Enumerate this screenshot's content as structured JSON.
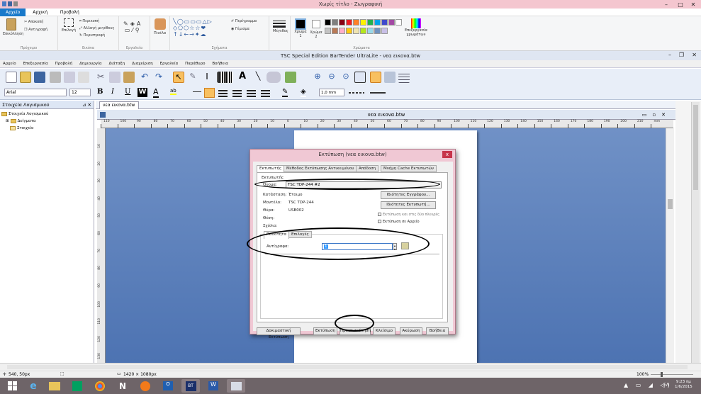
{
  "paint": {
    "title": "Χωρίς τίτλο - Ζωγραφική",
    "tabs": [
      "Αρχείο",
      "Αρχική",
      "Προβολή"
    ],
    "clipboard": {
      "paste": "Επικόλληση",
      "cut": "Αποκοπή",
      "copy": "Αντιγραφή",
      "label": "Πρόχειρο"
    },
    "image": {
      "select": "Επιλογή",
      "crop": "Περικοπή",
      "resize": "Αλλαγή μεγέθους",
      "rotate": "Περιστροφή",
      "label": "Εικόνα"
    },
    "tools": {
      "label": "Εργαλεία"
    },
    "brushes": {
      "label": "Πινέλα"
    },
    "shapes": {
      "outline": "Περίγραμμα",
      "fill": "Γέμισμα",
      "label": "Σχήματα"
    },
    "size": {
      "label": "Μέγεθος"
    },
    "colors": {
      "color1": "Χρώμα 1",
      "color2": "Χρώμα 2",
      "edit": "Επεξεργασία χρωμάτων",
      "label": "Χρώματα"
    },
    "palette": [
      "#000000",
      "#7f7f7f",
      "#880015",
      "#ed1c24",
      "#ff7f27",
      "#fff200",
      "#22b14c",
      "#00a2e8",
      "#3f48cc",
      "#a349a4",
      "#ffffff",
      "#c3c3c3",
      "#b97a57",
      "#ffaec9",
      "#ffc90e",
      "#efe4b0",
      "#b5e61d",
      "#99d9ea",
      "#7092be",
      "#c8bfe7"
    ]
  },
  "bartender": {
    "title": "TSC Special Edition BarTender UltraLite - νεα εικονα.btw",
    "menu": [
      "Αρχείο",
      "Επεξεργασία",
      "Προβολή",
      "Δημιουργία",
      "Διάταξη",
      "Διαχείριση",
      "Εργαλεία",
      "Παράθυρο",
      "Βοήθεια"
    ],
    "font_name": "Arial",
    "font_size": "12",
    "bold": "B",
    "italic": "I",
    "underline": "U",
    "line_width": "1,0 mm",
    "tree_title": "Στοιχεία Λογισμικού",
    "tree_items": [
      "Στοιχεία Λογισμικού",
      "Δείγματα",
      "Στοιχείο"
    ],
    "doc_tab": "νεα εικονα.btw",
    "doc_title": "νεα εικονα.btw",
    "ruler_h": [
      "110",
      "100",
      "90",
      "80",
      "70",
      "60",
      "50",
      "40",
      "30",
      "20",
      "10",
      "0",
      "10",
      "20",
      "30",
      "40",
      "50",
      "60",
      "70",
      "80",
      "90",
      "100",
      "110",
      "120",
      "130",
      "140",
      "150",
      "160",
      "170",
      "180",
      "190",
      "200",
      "210",
      "mm"
    ],
    "ruler_v": [
      "10",
      "20",
      "30",
      "40",
      "50",
      "60",
      "70",
      "80",
      "90",
      "100",
      "110",
      "120",
      "130"
    ]
  },
  "dialog": {
    "title": "Εκτύπωση (νεα εικονα.btw)",
    "close": "x",
    "tabs": [
      "Εκτυπωτής",
      "Μέθοδος Εκτύπωσης Αντικειμένου",
      "Απόδοση",
      "Μνήμη Cache Εκτυπωτών"
    ],
    "section_printer": "Εκτυπωτής",
    "name_label": "Όνομα:",
    "printer_name": "TSC TDP-244 #2",
    "status_label": "Κατάσταση:",
    "status_value": "Έτοιμο",
    "model_label": "Μοντέλο:",
    "model_value": "TSC TDP-244",
    "port_label": "Θύρα:",
    "port_value": "USB002",
    "location_label": "Θέση:",
    "comment_label": "Σχόλιο:",
    "doc_properties": "Ιδιότητες Εγγράφου...",
    "printer_properties": "Ιδιότητες Εκτυπωτή...",
    "opt_print_each": "Εκτύπωση και στις δύο πλευρές",
    "opt_print_file": "Εκτύπωση σε Αρχείο",
    "qty_tabs": [
      "Ποσότητα",
      "Επιλογές"
    ],
    "copies_label": "Αντίγραφα:",
    "copies_value": "1",
    "buttons": [
      "Δοκιμαστική Εκτύπωση",
      "Εκτύπωση",
      "Προεπισκόπηση",
      "Κλείσιμο",
      "Ακύρωση",
      "Βοήθεια"
    ]
  },
  "status": {
    "coords": "540, 50px",
    "size": "1420 × 1080px",
    "zoom": "100%"
  },
  "taskbar": {
    "time": "9:23 πμ",
    "date": "1/6/2015",
    "lang": "ΕΛ"
  }
}
